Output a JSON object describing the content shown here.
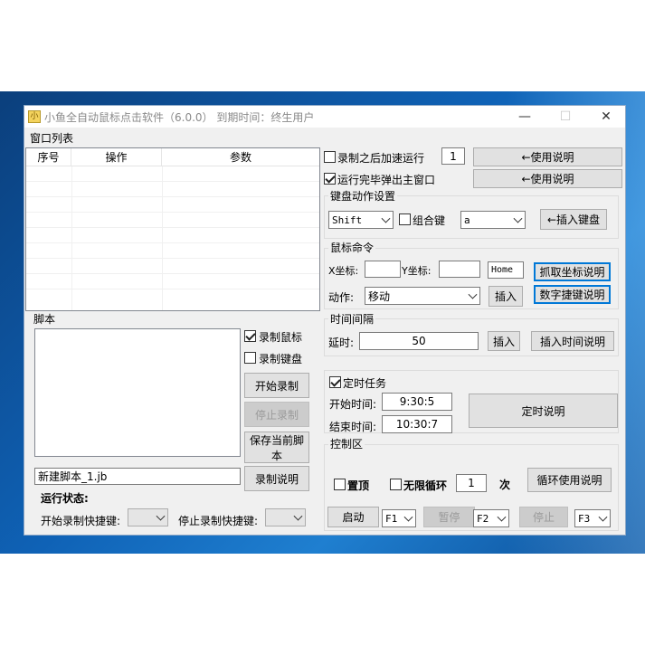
{
  "window": {
    "title": "小鱼全自动鼠标点击软件（6.0.0）  到期时间：终生用户",
    "icon_text": "小",
    "minimize_glyph": "—",
    "maximize_glyph": "☐",
    "close_glyph": "✕"
  },
  "menu": {
    "window_list": "窗口列表"
  },
  "table": {
    "columns": [
      "序号",
      "操作",
      "参数"
    ]
  },
  "script": {
    "group_label": "脚本",
    "record_mouse": "录制鼠标",
    "record_keyboard": "录制键盘",
    "start_record": "开始录制",
    "stop_record": "停止录制",
    "save_script": "保存当前脚本",
    "filename": "新建脚本_1.jb",
    "record_help": "录制说明",
    "run_status_label": "运行状态:",
    "start_hotkey_label": "开始录制快捷键:",
    "stop_hotkey_label": "停止录制快捷键:"
  },
  "options": {
    "speed_after_record": "录制之后加速运行",
    "speed_value": "1",
    "popup_after_run": "运行完毕弹出主窗口",
    "help1": "←使用说明",
    "help2": "←使用说明"
  },
  "keyboard": {
    "group_label": "键盘动作设置",
    "key": "Shift",
    "combo_label": "组合键",
    "combo_key": "a",
    "insert_key": "←插入键盘"
  },
  "mouse": {
    "group_label": "鼠标命令",
    "x_label": "X坐标:",
    "y_label": "Y坐标:",
    "x_value": "",
    "y_value": "",
    "hotkey_field": "Home",
    "grab_help": "抓取坐标说明",
    "action_label": "动作:",
    "action_value": "移动",
    "insert": "插入",
    "number_hotkey_help": "数字捷键说明"
  },
  "interval": {
    "group_label": "时间间隔",
    "delay_label": "延时:",
    "delay_value": "50",
    "insert": "插入",
    "insert_time_help": "插入时间说明"
  },
  "timer": {
    "label": "定时任务",
    "start_label": "开始时间:",
    "start_value": "9:30:5",
    "end_label": "结束时间:",
    "end_value": "10:30:7",
    "help": "定时说明"
  },
  "control": {
    "group_label": "控制区",
    "topmost": "置顶",
    "infinite_loop": "无限循环",
    "loop_count": "1",
    "times_label": "次",
    "loop_help": "循环使用说明",
    "start": "启动",
    "start_key": "F1",
    "pause": "暂停",
    "pause_key": "F2",
    "stop": "停止",
    "stop_key": "F3"
  }
}
